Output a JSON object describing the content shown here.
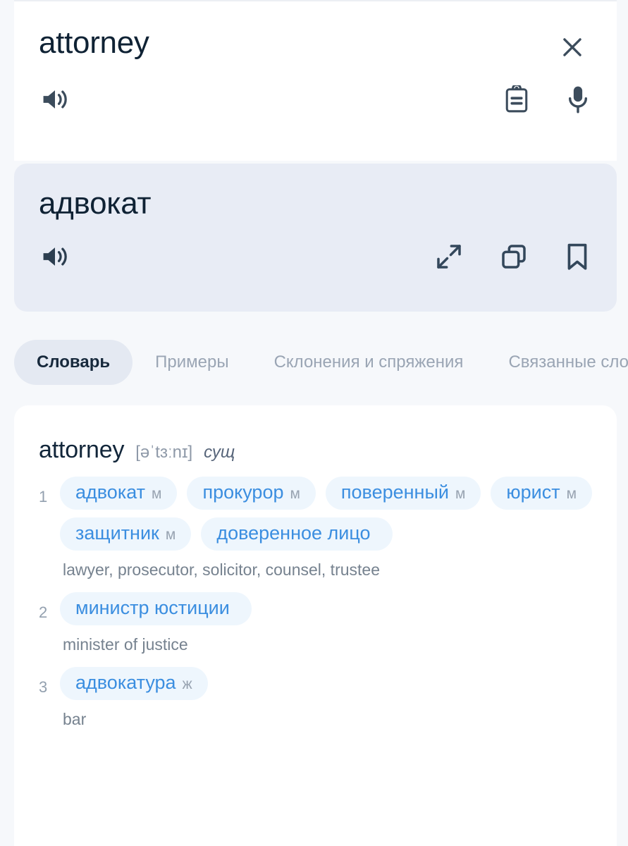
{
  "source": {
    "word": "attorney",
    "close_label": "×",
    "icons": {
      "speaker": "speaker-icon",
      "paste": "clipboard-icon",
      "mic": "microphone-icon",
      "close": "close-icon"
    }
  },
  "translation": {
    "word": "адвокат",
    "panel_bg": "#e8ecf5",
    "icons": {
      "speaker": "speaker-icon",
      "expand": "expand-icon",
      "copy": "copy-icon",
      "bookmark": "bookmark-icon"
    }
  },
  "tabs": [
    {
      "label": "Словарь",
      "active": true
    },
    {
      "label": "Примеры",
      "active": false
    },
    {
      "label": "Склонения и спряжения",
      "active": false
    },
    {
      "label": "Связанные слова",
      "active": false
    }
  ],
  "dictionary": {
    "headword": "attorney",
    "transcription": "[əˈtɜːnɪ]",
    "part_of_speech": "сущ",
    "accent_color": "#3b8ee0",
    "chip_bg": "#eef6fd",
    "senses": [
      {
        "number": "1",
        "translations": [
          {
            "text": "адвокат",
            "gender": "м"
          },
          {
            "text": "прокурор",
            "gender": "м"
          },
          {
            "text": "поверенный",
            "gender": "м"
          },
          {
            "text": "юрист",
            "gender": "м"
          },
          {
            "text": "защитник",
            "gender": "м"
          },
          {
            "text": "доверенное лицо",
            "gender": ""
          }
        ],
        "gloss": "lawyer, prosecutor, solicitor, counsel, trustee"
      },
      {
        "number": "2",
        "translations": [
          {
            "text": "министр юстиции",
            "gender": ""
          }
        ],
        "gloss": "minister of justice"
      },
      {
        "number": "3",
        "translations": [
          {
            "text": "адвокатура",
            "gender": "ж"
          }
        ],
        "gloss": "bar"
      }
    ]
  }
}
